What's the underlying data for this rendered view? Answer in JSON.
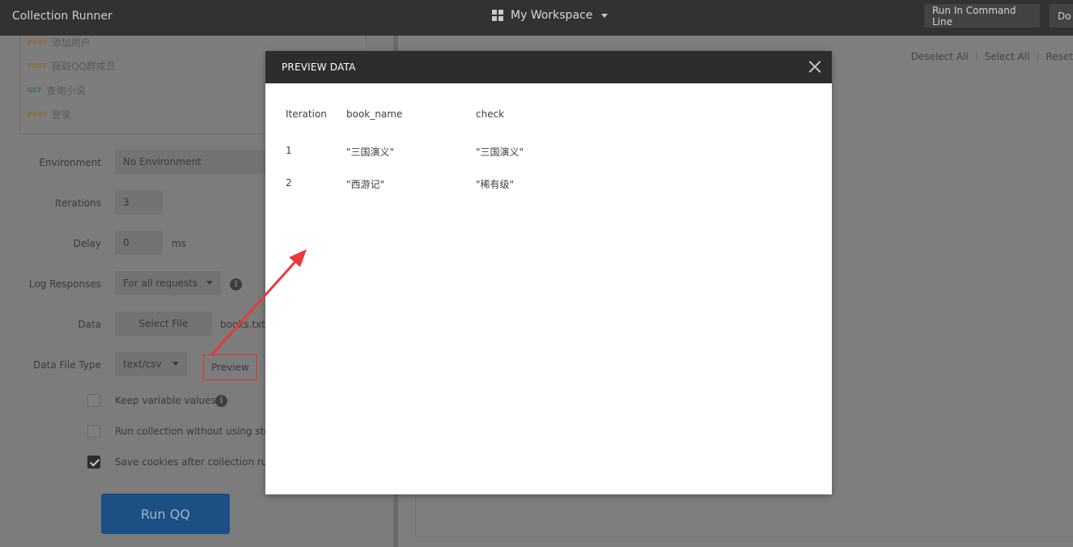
{
  "header": {
    "title": "Collection Runner",
    "workspace": "My Workspace",
    "run_cmd": "Run In Command Line",
    "docs": "Do"
  },
  "requests": [
    {
      "method": "POST",
      "name": "添加用户"
    },
    {
      "method": "POST",
      "name": "获取QQ群成员"
    },
    {
      "method": "GET",
      "name": "查询小说"
    },
    {
      "method": "POST",
      "name": "登录"
    }
  ],
  "form": {
    "environment_label": "Environment",
    "environment_value": "No Environment",
    "iterations_label": "Iterations",
    "iterations_value": "3",
    "delay_label": "Delay",
    "delay_value": "0",
    "delay_unit": "ms",
    "log_label": "Log Responses",
    "log_value": "For all requests",
    "data_label": "Data",
    "select_file": "Select File",
    "file_name": "books.txt",
    "data_type_label": "Data File Type",
    "data_type_value": "text/csv",
    "preview": "Preview",
    "keep_vars": "Keep variable values",
    "run_without_storage": "Run collection without using stored cookies",
    "save_cookies": "Save cookies after collection run",
    "run_button": "Run QQ"
  },
  "right": {
    "deselect_all": "Deselect All",
    "select_all": "Select All",
    "reset": "Reset"
  },
  "modal": {
    "title": "PREVIEW DATA",
    "columns": [
      "Iteration",
      "book_name",
      "check"
    ],
    "rows": [
      [
        "1",
        "\"三国演义\"",
        "\"三国演义\""
      ],
      [
        "2",
        "\"西游记\"",
        "\"稀有级\""
      ]
    ]
  },
  "colors": {
    "annotation": "#e83a3a",
    "run_button": "#2f80d1"
  }
}
